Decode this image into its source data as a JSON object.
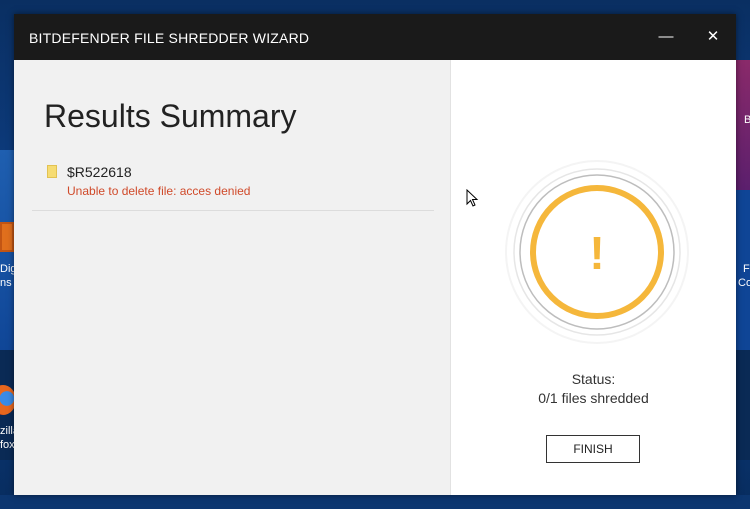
{
  "window": {
    "title": "BITDEFENDER FILE SHREDDER WIZARD",
    "minimize_glyph": "—",
    "close_glyph": "✕"
  },
  "results": {
    "heading": "Results Summary",
    "files": [
      {
        "name": "$R522618",
        "error": "Unable to delete file: acces denied"
      }
    ]
  },
  "status": {
    "symbol": "!",
    "label": "Status:",
    "value": "0/1 files shredded",
    "accent_color": "#f5b73b"
  },
  "actions": {
    "finish_label": "FINISH"
  },
  "desktop": {
    "left_labels": [
      "Dig",
      "ns i"
    ],
    "left_labels_bottom": [
      "zilla",
      "fox"
    ],
    "right_labels": [
      "F",
      "Co"
    ],
    "right_top_label": "B"
  },
  "icons": [
    "minimize-icon",
    "close-icon",
    "folder-icon",
    "warning-icon",
    "mouse-cursor-icon",
    "firefox-icon"
  ]
}
